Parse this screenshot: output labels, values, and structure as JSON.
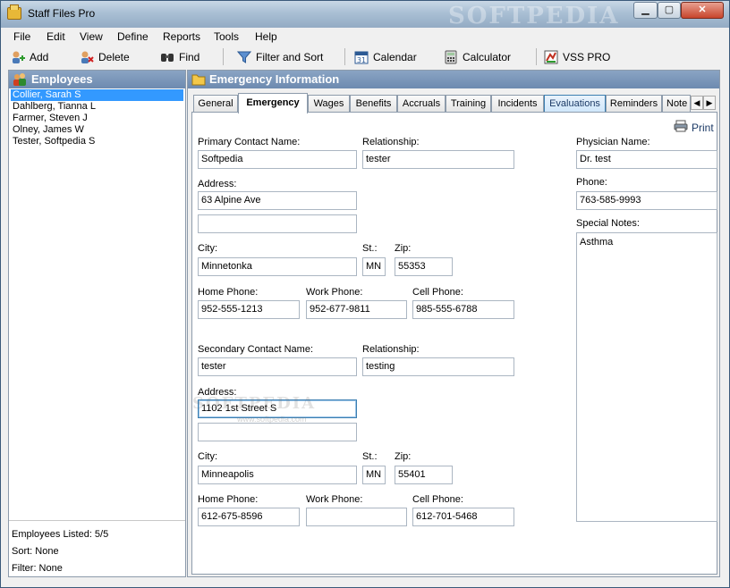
{
  "window": {
    "title": "Staff Files Pro",
    "watermark": "SOFTPEDIA",
    "min_label": "▁",
    "max_label": "▢",
    "close_label": "✕"
  },
  "menu": [
    "File",
    "Edit",
    "View",
    "Define",
    "Reports",
    "Tools",
    "Help"
  ],
  "toolbar": {
    "add": "Add",
    "delete": "Delete",
    "find": "Find",
    "filter_sort": "Filter and Sort",
    "calendar": "Calendar",
    "calculator": "Calculator",
    "vss_pro": "VSS PRO"
  },
  "employees": {
    "header": "Employees",
    "selected_index": 0,
    "items": [
      "Collier, Sarah S",
      "Dahlberg, Tianna L",
      "Farmer, Steven J",
      "Olney, James W",
      "Tester, Softpedia S"
    ],
    "listed": "Employees Listed: 5/5",
    "sort": "Sort: None",
    "filter": "Filter: None"
  },
  "info": {
    "header": "Emergency Information",
    "tabs": [
      "General",
      "Emergency",
      "Wages",
      "Benefits",
      "Accruals",
      "Training",
      "Incidents",
      "Evaluations",
      "Reminders",
      "Note"
    ],
    "active_tab": "Emergency",
    "print": "Print"
  },
  "primary": {
    "contact_label": "Primary Contact Name:",
    "contact": "Softpedia",
    "relationship_label": "Relationship:",
    "relationship": "tester",
    "address_label": "Address:",
    "address1": "63 Alpine Ave",
    "address2": "",
    "city_label": "City:",
    "city": "Minnetonka",
    "state_label": "St.:",
    "state": "MN",
    "zip_label": "Zip:",
    "zip": "55353",
    "home_phone_label": "Home Phone:",
    "home_phone": "952-555-1213",
    "work_phone_label": "Work Phone:",
    "work_phone": "952-677-9811",
    "cell_phone_label": "Cell Phone:",
    "cell_phone": "985-555-6788"
  },
  "secondary": {
    "contact_label": "Secondary Contact Name:",
    "contact": "tester",
    "relationship_label": "Relationship:",
    "relationship": "testing",
    "address_label": "Address:",
    "address1": "1102 1st Street S",
    "address2": "",
    "city_label": "City:",
    "city": "Minneapolis",
    "state_label": "St.:",
    "state": "MN",
    "zip_label": "Zip:",
    "zip": "55401",
    "home_phone_label": "Home Phone:",
    "home_phone": "612-675-8596",
    "work_phone_label": "Work Phone:",
    "work_phone": "",
    "cell_phone_label": "Cell Phone:",
    "cell_phone": "612-701-5468"
  },
  "physician": {
    "name_label": "Physician Name:",
    "name": "Dr. test",
    "phone_label": "Phone:",
    "phone": "763-585-9993",
    "notes_label": "Special Notes:",
    "notes": "Asthma"
  },
  "overlay": {
    "softpedia_url": "www.softpedia.com"
  },
  "colors": {
    "selection": "#3399ff",
    "panel_header": "#7a96bc",
    "tab_highlight": "#cfe6fb"
  },
  "icons": [
    "folder-icon",
    "add-icon",
    "delete-icon",
    "find-icon",
    "filter-icon",
    "calendar-icon",
    "calculator-icon",
    "vss-icon",
    "people-icon",
    "print-icon",
    "chevron-left-icon",
    "chevron-right-icon"
  ]
}
